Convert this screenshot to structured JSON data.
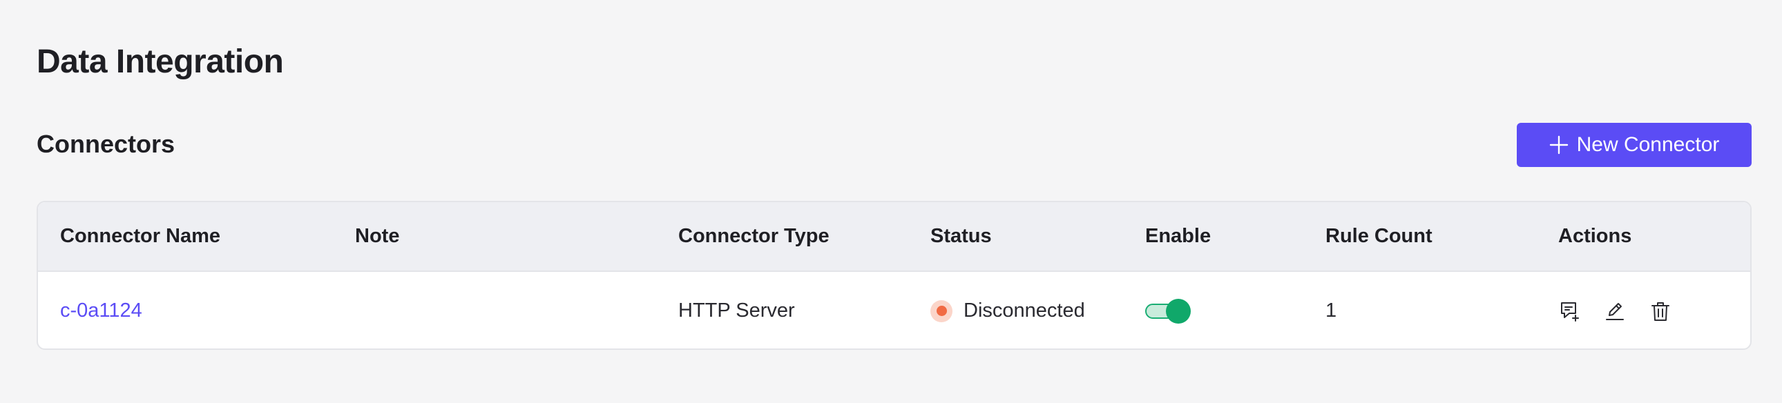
{
  "page": {
    "title": "Data Integration"
  },
  "section": {
    "title": "Connectors",
    "new_button_label": "New Connector",
    "new_button_icon": "plus-icon"
  },
  "table": {
    "columns": [
      "Connector Name",
      "Note",
      "Connector Type",
      "Status",
      "Enable",
      "Rule Count",
      "Actions"
    ],
    "rows": [
      {
        "name": "c-0a1124",
        "note": "",
        "type": "HTTP Server",
        "status": "Disconnected",
        "status_color": "#f16a43",
        "enabled": true,
        "rule_count": "1",
        "actions": [
          "create-rule-icon",
          "edit-icon",
          "delete-icon"
        ]
      }
    ]
  },
  "colors": {
    "accent": "#5b4cf5",
    "toggle_on": "#10a86a",
    "status_disconnected": "#f16a43"
  }
}
